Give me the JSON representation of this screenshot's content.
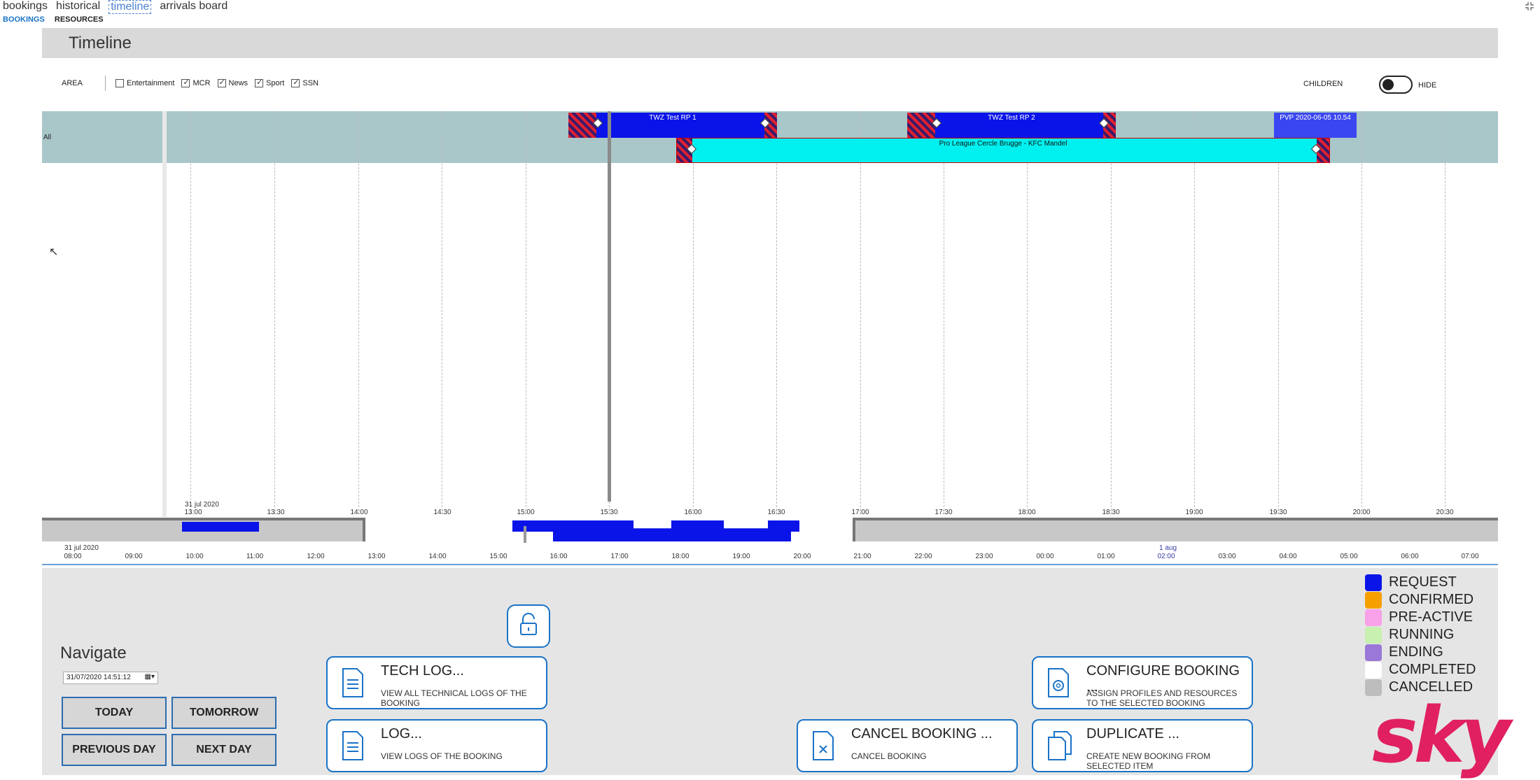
{
  "nav": {
    "tabs": [
      "bookings",
      "historical",
      "timeline",
      "arrivals board"
    ],
    "active": "timeline"
  },
  "subnav": {
    "bookings": "BOOKINGS",
    "resources": "RESOURCES"
  },
  "page_title": "Timeline",
  "filters": {
    "area_label": "AREA",
    "items": [
      {
        "label": "Entertainment",
        "checked": false
      },
      {
        "label": "MCR",
        "checked": true
      },
      {
        "label": "News",
        "checked": true
      },
      {
        "label": "Sport",
        "checked": true
      },
      {
        "label": "SSN",
        "checked": true
      }
    ],
    "children_label": "CHILDREN",
    "hide_label": "HIDE"
  },
  "timeline": {
    "row_label": "All",
    "date_label": "31 jul 2020",
    "ticks": [
      "13:00",
      "13:30",
      "14:00",
      "14:30",
      "15:00",
      "15:30",
      "16:00",
      "16:30",
      "17:00",
      "17:30",
      "18:00",
      "18:30",
      "19:00",
      "19:30",
      "20:00",
      "20:30"
    ],
    "bookings": [
      {
        "title": "TWZ Test RP 1",
        "color": "#0a14e8"
      },
      {
        "title": "TWZ Test RP 2",
        "color": "#0a14e8"
      },
      {
        "title": "PVP 2020-06-05 10.54",
        "color": "#3a46f0"
      },
      {
        "title": "Pro League Cercle Brugge - KFC Mandel",
        "color": "#00f0f0"
      }
    ]
  },
  "overview": {
    "date_start": "31 jul 2020",
    "date_next": "1 aug",
    "ticks": [
      "08:00",
      "09:00",
      "10:00",
      "11:00",
      "12:00",
      "13:00",
      "14:00",
      "15:00",
      "16:00",
      "17:00",
      "18:00",
      "19:00",
      "20:00",
      "21:00",
      "22:00",
      "23:00",
      "00:00",
      "01:00",
      "02:00",
      "03:00",
      "04:00",
      "05:00",
      "06:00",
      "07:00"
    ]
  },
  "navigate": {
    "title": "Navigate",
    "datetime": "31/07/2020 14:51:12",
    "today": "TODAY",
    "tomorrow": "TOMORROW",
    "previous_day": "PREVIOUS DAY",
    "next_day": "NEXT DAY"
  },
  "actions": {
    "tech_log": {
      "title": "TECH LOG...",
      "desc": "VIEW ALL TECHNICAL LOGS OF THE BOOKING"
    },
    "log": {
      "title": "LOG...",
      "desc": "VIEW LOGS OF THE BOOKING"
    },
    "cancel": {
      "title": "CANCEL BOOKING ...",
      "desc": "CANCEL BOOKING"
    },
    "configure": {
      "title": "CONFIGURE BOOKING ...",
      "desc": "ASSIGN PROFILES AND RESOURCES TO THE SELECTED BOOKING"
    },
    "duplicate": {
      "title": "DUPLICATE ...",
      "desc": "CREATE NEW BOOKING FROM SELECTED ITEM"
    }
  },
  "legend": [
    {
      "label": "REQUEST",
      "color": "#0a14e8"
    },
    {
      "label": "CONFIRMED",
      "color": "#f5a000"
    },
    {
      "label": "PRE-ACTIVE",
      "color": "#f8a0e8"
    },
    {
      "label": "RUNNING",
      "color": "#c8f0b0"
    },
    {
      "label": "ENDING",
      "color": "#9a78d8"
    },
    {
      "label": "COMPLETED",
      "color": "#ffffff"
    },
    {
      "label": "CANCELLED",
      "color": "#bdbdbd"
    }
  ],
  "brand": "sky"
}
